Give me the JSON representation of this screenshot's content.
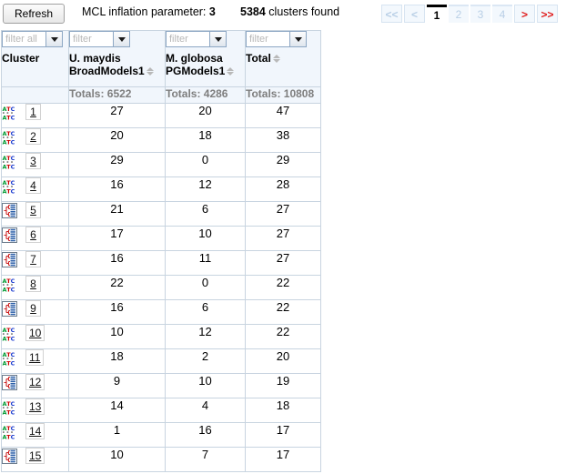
{
  "toolbar": {
    "refresh_label": "Refresh",
    "mcl_label": "MCL inflation parameter:",
    "mcl_value": "3",
    "clusters_count": "5384",
    "clusters_label": "clusters found"
  },
  "pagination": {
    "first_label": "<<",
    "prev_label": "<",
    "pages": [
      "1",
      "2",
      "3",
      "4"
    ],
    "current_page": "1",
    "next_label": ">",
    "last_label": ">>"
  },
  "table": {
    "columns": [
      {
        "name": "Cluster",
        "filter_placeholder": "filter all",
        "sortable": false,
        "totals": ""
      },
      {
        "name": "U. maydis BroadModels1",
        "filter_placeholder": "filter",
        "sortable": true,
        "totals": "Totals: 6522"
      },
      {
        "name": "M. globosa PGModels1",
        "filter_placeholder": "filter",
        "sortable": true,
        "totals": "Totals: 4286"
      },
      {
        "name": "Total",
        "filter_placeholder": "filter",
        "sortable": true,
        "totals": "Totals: 10808"
      }
    ],
    "column_name_lines": [
      [
        "Cluster"
      ],
      [
        "U. maydis",
        "BroadModels1"
      ],
      [
        "M. globosa",
        "PGModels1"
      ],
      [
        "Total"
      ]
    ],
    "rows": [
      {
        "icon": "dna-alignment-icon",
        "cluster": "1",
        "u_maydis": "27",
        "m_globosa": "20",
        "total": "47"
      },
      {
        "icon": "dna-alignment-icon",
        "cluster": "2",
        "u_maydis": "20",
        "m_globosa": "18",
        "total": "38"
      },
      {
        "icon": "dna-alignment-icon",
        "cluster": "3",
        "u_maydis": "29",
        "m_globosa": "0",
        "total": "29"
      },
      {
        "icon": "dna-alignment-icon",
        "cluster": "4",
        "u_maydis": "16",
        "m_globosa": "12",
        "total": "28"
      },
      {
        "icon": "phylo-tree-icon",
        "cluster": "5",
        "u_maydis": "21",
        "m_globosa": "6",
        "total": "27"
      },
      {
        "icon": "phylo-tree-icon",
        "cluster": "6",
        "u_maydis": "17",
        "m_globosa": "10",
        "total": "27"
      },
      {
        "icon": "phylo-tree-icon",
        "cluster": "7",
        "u_maydis": "16",
        "m_globosa": "11",
        "total": "27"
      },
      {
        "icon": "dna-alignment-icon",
        "cluster": "8",
        "u_maydis": "22",
        "m_globosa": "0",
        "total": "22"
      },
      {
        "icon": "phylo-tree-icon",
        "cluster": "9",
        "u_maydis": "16",
        "m_globosa": "6",
        "total": "22"
      },
      {
        "icon": "dna-alignment-icon",
        "cluster": "10",
        "u_maydis": "10",
        "m_globosa": "12",
        "total": "22"
      },
      {
        "icon": "dna-alignment-icon",
        "cluster": "11",
        "u_maydis": "18",
        "m_globosa": "2",
        "total": "20"
      },
      {
        "icon": "phylo-tree-icon",
        "cluster": "12",
        "u_maydis": "9",
        "m_globosa": "10",
        "total": "19"
      },
      {
        "icon": "dna-alignment-icon",
        "cluster": "13",
        "u_maydis": "14",
        "m_globosa": "4",
        "total": "18"
      },
      {
        "icon": "dna-alignment-icon",
        "cluster": "14",
        "u_maydis": "1",
        "m_globosa": "16",
        "total": "17"
      },
      {
        "icon": "phylo-tree-icon",
        "cluster": "15",
        "u_maydis": "10",
        "m_globosa": "7",
        "total": "17"
      }
    ]
  },
  "colors": {
    "header_bg": "#f1f6fc",
    "grid_border": "#c8d4e0",
    "totals_text": "#7e7e7e",
    "pagination_inactive": "#b9cfe6",
    "pagination_arrow_active": "#e02020"
  }
}
